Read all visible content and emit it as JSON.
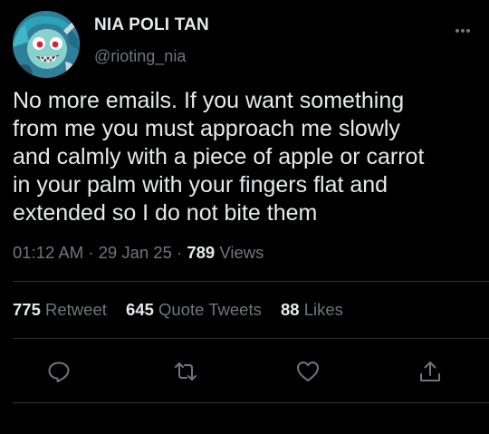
{
  "author": {
    "name": "NIA POLI TAN",
    "handle": "@rioting_nia"
  },
  "tweet": {
    "text": "No more emails. If you want something\nfrom me you must approach me slowly\nand calmly with a piece of apple or carrot\nin your palm with your fingers flat and\nextended so I do not bite them",
    "time": "01:12 AM",
    "date": "29 Jan 25",
    "views_count": "789",
    "views_label": "Views"
  },
  "stats": {
    "retweets_count": "775",
    "retweets_label": "Retweet",
    "quotes_count": "645",
    "quotes_label": "Quote Tweets",
    "likes_count": "88",
    "likes_label": "Likes"
  },
  "colors": {
    "background": "#000000",
    "primary_text": "#e7e9ea",
    "secondary_text": "#71767b",
    "divider": "#2f3336"
  },
  "icons": {
    "more": "more-icon",
    "reply": "reply-icon",
    "retweet": "retweet-icon",
    "like": "heart-icon",
    "share": "share-icon"
  }
}
